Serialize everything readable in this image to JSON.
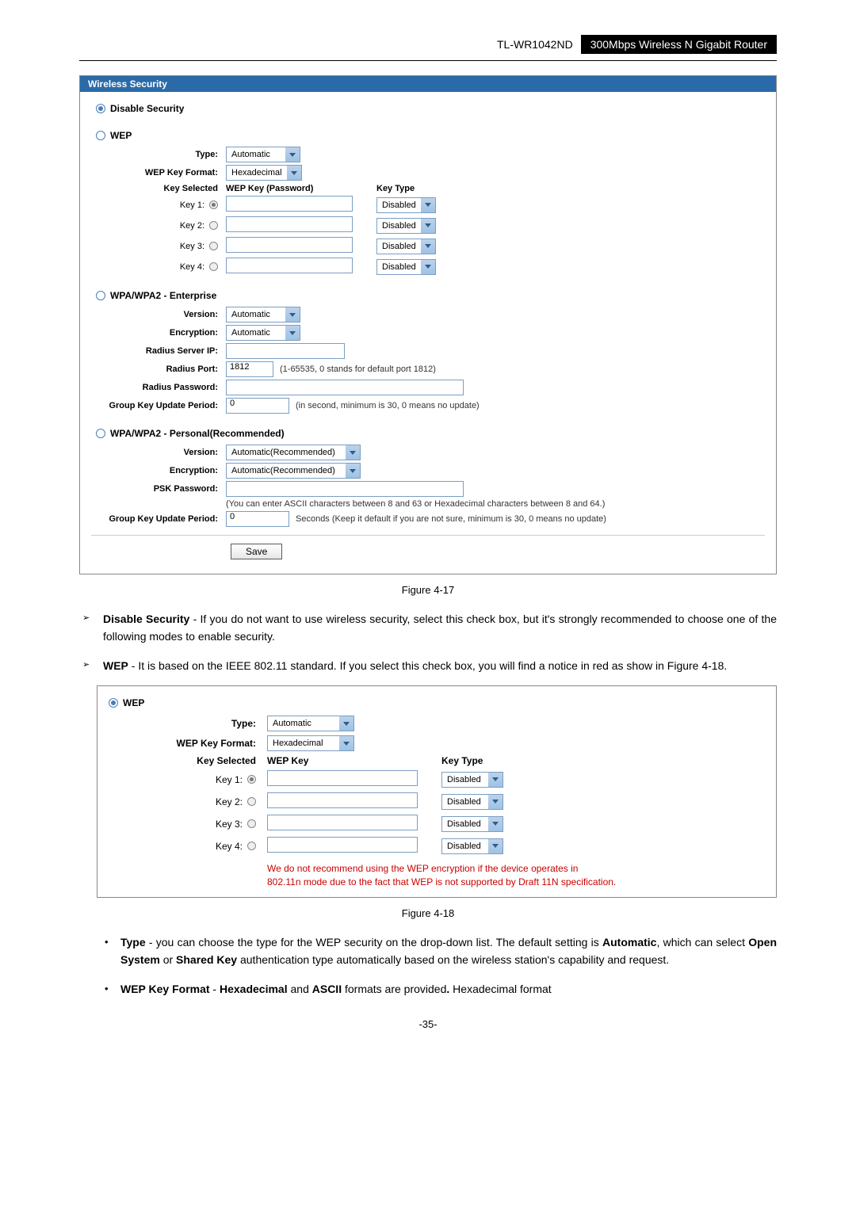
{
  "header": {
    "model": "TL-WR1042ND",
    "product": "300Mbps Wireless N Gigabit Router"
  },
  "panel1": {
    "title": "Wireless Security",
    "opt_disable": "Disable Security",
    "wep": {
      "title": "WEP",
      "type_label": "Type:",
      "type_value": "Automatic",
      "format_label": "WEP Key Format:",
      "format_value": "Hexadecimal",
      "key_selected": "Key Selected",
      "key_col": "WEP Key (Password)",
      "type_col": "Key Type",
      "rows": [
        {
          "label": "Key 1:",
          "type": "Disabled"
        },
        {
          "label": "Key 2:",
          "type": "Disabled"
        },
        {
          "label": "Key 3:",
          "type": "Disabled"
        },
        {
          "label": "Key 4:",
          "type": "Disabled"
        }
      ]
    },
    "ent": {
      "title": "WPA/WPA2 - Enterprise",
      "version_label": "Version:",
      "version_value": "Automatic",
      "enc_label": "Encryption:",
      "enc_value": "Automatic",
      "ip_label": "Radius Server IP:",
      "port_label": "Radius Port:",
      "port_value": "1812",
      "port_hint": "(1-65535, 0 stands for default port 1812)",
      "pwd_label": "Radius Password:",
      "grp_label": "Group Key Update Period:",
      "grp_value": "0",
      "grp_hint": "(in second, minimum is 30, 0 means no update)"
    },
    "per": {
      "title": "WPA/WPA2 - Personal(Recommended)",
      "version_label": "Version:",
      "version_value": "Automatic(Recommended)",
      "enc_label": "Encryption:",
      "enc_value": "Automatic(Recommended)",
      "psk_label": "PSK Password:",
      "psk_hint": "(You can enter ASCII characters between 8 and 63 or Hexadecimal characters between 8 and 64.)",
      "grp_label": "Group Key Update Period:",
      "grp_value": "0",
      "grp_hint": "Seconds (Keep it default if you are not sure, minimum is 30, 0 means no update)"
    },
    "save": "Save"
  },
  "caption1": "Figure 4-17",
  "bullets": [
    {
      "lead": "Disable Security",
      "rest": " - If you do not want to use wireless security, select this check box, but it's strongly recommended to choose one of the following modes to enable security."
    },
    {
      "lead": "WEP",
      "rest": " - It is based on the IEEE 802.11 standard. If you select this check box, you will find a notice in red as show in Figure 4-18."
    }
  ],
  "panel2": {
    "title": "WEP",
    "type_label": "Type:",
    "type_value": "Automatic",
    "format_label": "WEP Key Format:",
    "format_value": "Hexadecimal",
    "key_selected": "Key Selected",
    "key_col": "WEP Key",
    "type_col": "Key Type",
    "rows": [
      {
        "label": "Key 1:",
        "type": "Disabled"
      },
      {
        "label": "Key 2:",
        "type": "Disabled"
      },
      {
        "label": "Key 3:",
        "type": "Disabled"
      },
      {
        "label": "Key 4:",
        "type": "Disabled"
      }
    ],
    "red1": "We do not recommend using the WEP encryption if the device operates in",
    "red2": "802.11n mode due to the fact that WEP is not supported by Draft 11N specification."
  },
  "caption2": "Figure 4-18",
  "subbullets": [
    {
      "lead": "Type",
      "rest": " - you can choose the type for the WEP security on the drop-down list. The default setting is ",
      "bold2": "Automatic",
      "rest2": ", which can select  ",
      "bold3": "Open System",
      "rest3": " or ",
      "bold4": "Shared Key",
      "rest4": " authentication type automatically based on the wireless station's capability and request."
    },
    {
      "lead": "WEP Key Format",
      "rest": " - ",
      "bold2": "Hexadecimal",
      "rest2": " and ",
      "bold3": "ASCII",
      "rest3": " formats are provided",
      "bold4": ".",
      "rest4": " Hexadecimal format"
    }
  ],
  "pagenum": "-35-"
}
